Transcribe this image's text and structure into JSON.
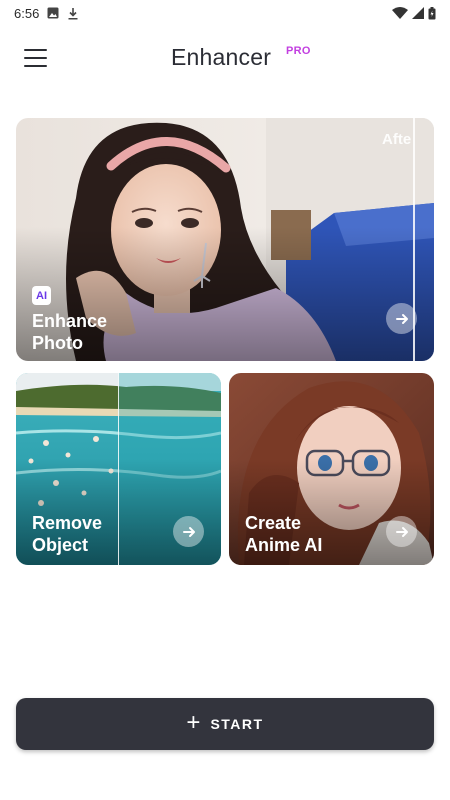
{
  "status_bar": {
    "time": "6:56",
    "icons": [
      "image-notification-icon",
      "download-icon",
      "wifi-icon",
      "cellular-signal-icon",
      "battery-icon"
    ]
  },
  "app_bar": {
    "title": "Enhancer",
    "badge": "PRO",
    "badge_color": "#c23fe0",
    "menu_icon": "hamburger-menu-icon"
  },
  "cards": {
    "enhance": {
      "ai_badge": "AI",
      "label_line1": "Enhance",
      "label_line2": "Photo",
      "after_label": "Afte",
      "arrow_icon": "arrow-right-icon"
    },
    "remove": {
      "label_line1": "Remove",
      "label_line2": "Object",
      "arrow_icon": "arrow-right-icon"
    },
    "anime": {
      "label_line1": "Create",
      "label_line2": "Anime AI",
      "arrow_icon": "arrow-right-icon"
    }
  },
  "start_button": {
    "icon": "plus-icon",
    "label": "START",
    "color": "#33343d"
  }
}
